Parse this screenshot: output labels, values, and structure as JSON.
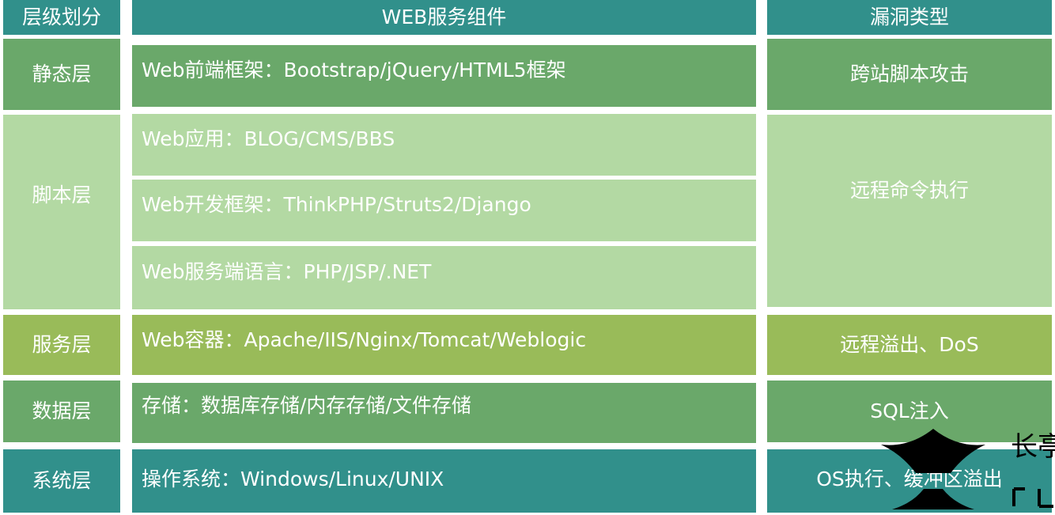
{
  "headers": {
    "layer": "层级划分",
    "component": "WEB服务组件",
    "vuln": "漏洞类型"
  },
  "rows": [
    {
      "layer": "静态层",
      "components": [
        "Web前端框架：Bootstrap/jQuery/HTML5框架"
      ],
      "vuln": "跨站脚本攻击"
    },
    {
      "layer": "脚本层",
      "components": [
        "Web应用：BLOG/CMS/BBS",
        "Web开发框架：ThinkPHP/Struts2/Django",
        "Web服务端语言：PHP/JSP/.NET"
      ],
      "vuln": "远程命令执行"
    },
    {
      "layer": "服务层",
      "components": [
        "Web容器：Apache/IIS/Nginx/Tomcat/Weblogic"
      ],
      "vuln": "远程溢出、DoS"
    },
    {
      "layer": "数据层",
      "components": [
        "存储：数据库存储/内存存储/文件存储"
      ],
      "vuln": "SQL注入"
    },
    {
      "layer": "系统层",
      "components": [
        "操作系统：Windows/Linux/UNIX"
      ],
      "vuln": "OS执行、缓冲区溢出"
    }
  ],
  "colors": {
    "teal": "#31908b",
    "green": "#6aa86a",
    "light_green": "#b3d9a3",
    "olive": "#99bb59"
  },
  "watermark": {
    "icon": "pagoda-roof-logo-icon",
    "text": "长亭"
  }
}
